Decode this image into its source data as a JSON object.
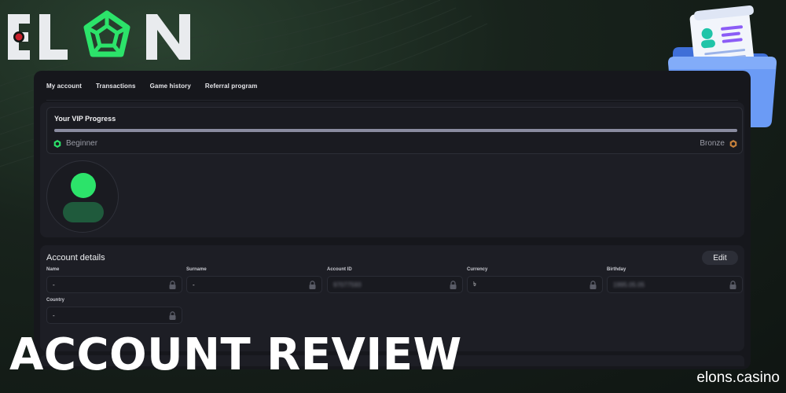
{
  "brand": {
    "logo_text": "ELON",
    "accent": "#2ce36a",
    "highlight": "#d4a22a"
  },
  "tabs": [
    {
      "label": "My account",
      "active": true
    },
    {
      "label": "Transactions",
      "active": false
    },
    {
      "label": "Game history",
      "active": false
    },
    {
      "label": "Referral program",
      "active": false
    }
  ],
  "vip": {
    "title": "Your VIP Progress",
    "progress": 1.0,
    "current_level": "Beginner",
    "next_level": "Bronze"
  },
  "account_details": {
    "title": "Account details",
    "edit_label": "Edit",
    "fields": [
      {
        "label": "Name",
        "value": "-",
        "blurred": false
      },
      {
        "label": "Surname",
        "value": "-",
        "blurred": false
      },
      {
        "label": "Account ID",
        "value": "97077593",
        "blurred": true
      },
      {
        "label": "Currency",
        "value": "৳",
        "blurred": false
      },
      {
        "label": "Birthday",
        "value": "1995.05.05",
        "blurred": true
      },
      {
        "label": "Country",
        "value": "-",
        "blurred": false
      }
    ]
  },
  "headline": "ACCOUNT REVIEW",
  "watermark": "elons.casino",
  "icons": [
    "logo-mark-icon",
    "folder-document-icon",
    "lock-icon",
    "level-badge-icon",
    "avatar-icon"
  ]
}
